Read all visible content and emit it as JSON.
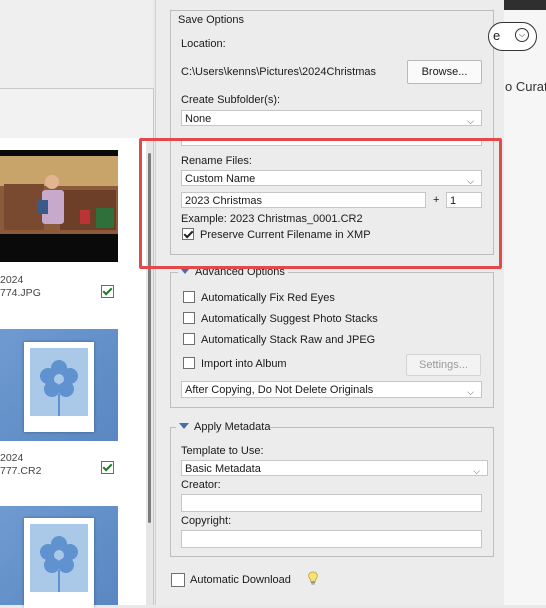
{
  "save_options": {
    "title": "Save Options",
    "location_label": "Location:",
    "location_value": "C:\\Users\\kenns\\Pictures\\2024Christmas",
    "browse_label": "Browse...",
    "subfolder_label": "Create Subfolder(s):",
    "subfolder_value": "None"
  },
  "rename": {
    "label": "Rename Files:",
    "mode_value": "Custom Name",
    "custom_text": "2023 Christmas",
    "plus": "+",
    "start_number": "1",
    "example": "Example:  2023 Christmas_0001.CR2",
    "preserve_label": "Preserve Current Filename in XMP",
    "preserve_checked": true
  },
  "advanced": {
    "title": "Advanced Options",
    "fix_red_eyes": "Automatically Fix Red Eyes",
    "suggest_stacks": "Automatically Suggest Photo Stacks",
    "stack_raw_jpeg": "Automatically Stack Raw and JPEG",
    "import_album": "Import into Album",
    "settings_label": "Settings...",
    "after_copy_value": "After Copying, Do Not Delete Originals"
  },
  "metadata": {
    "title": "Apply Metadata",
    "template_label": "Template to Use:",
    "template_value": "Basic Metadata",
    "creator_label": "Creator:",
    "creator_value": "",
    "copyright_label": "Copyright:",
    "copyright_value": ""
  },
  "auto_download": {
    "label": "Automatic Download",
    "checked": false
  },
  "thumbnails": [
    {
      "line1": "2024",
      "line2": "774.JPG",
      "checked": true
    },
    {
      "line1": "2024",
      "line2": "777.CR2",
      "checked": true
    }
  ],
  "right_strip": {
    "pill_text": "e",
    "curate_text": "o Curate"
  },
  "colors": {
    "highlight": "#e24a4a",
    "tile_blue": "#6f9bd1",
    "disclosure": "#4a6fa8"
  }
}
